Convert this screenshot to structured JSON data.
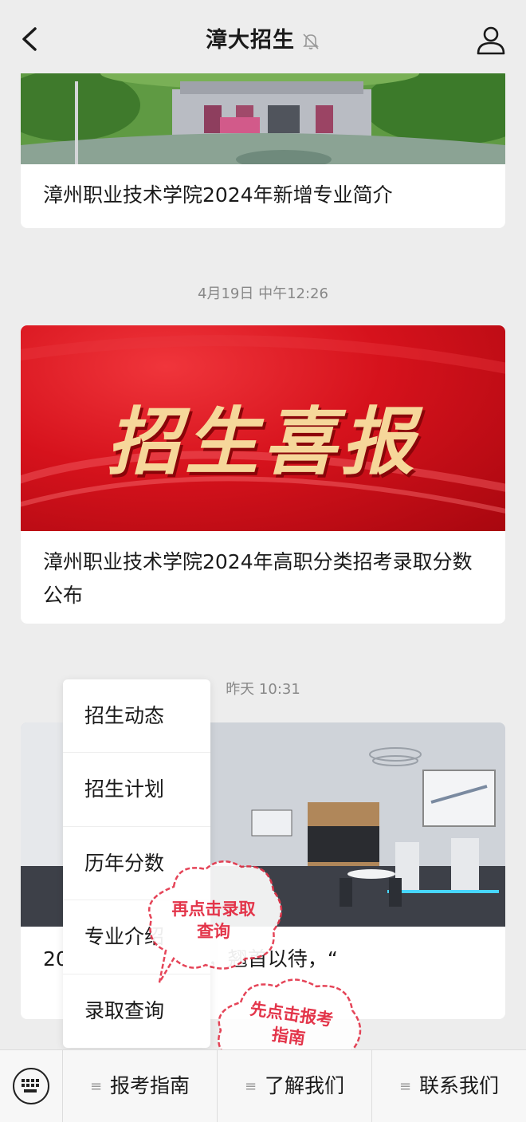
{
  "header": {
    "title": "漳大招生"
  },
  "feed": {
    "articles": [
      {
        "title": "漳州职业技术学院2024年新增专业简介"
      },
      {
        "timestamp": "4月19日 中午12:26",
        "image_headline": "招生喜报",
        "title": "漳州职业技术学院2024年高职分类招考录取分数公布"
      },
      {
        "timestamp": "昨天 10:31",
        "title": "20…智…漳大智造，翘首以待，“"
      }
    ]
  },
  "menu": {
    "items": [
      "招生动态",
      "招生计划",
      "历年分数",
      "专业介绍",
      "录取查询"
    ]
  },
  "bottom_tabs": [
    "报考指南",
    "了解我们",
    "联系我们"
  ],
  "hints": {
    "first": "先点击报考指南",
    "second": "再点击录取查询"
  },
  "colors": {
    "background": "#ededed",
    "hint_red": "#e3354a",
    "banner_red": "#d6121c",
    "banner_gold": "#f6d79a"
  }
}
